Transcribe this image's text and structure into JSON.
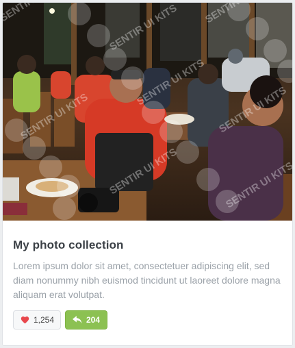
{
  "card": {
    "title": "My photo collection",
    "description": "Lorem ipsum dolor sit amet, consectetuer adipiscing elit, sed diam nonummy nibh euismod tincidunt ut laoreet dolore magna aliquam erat volutpat.",
    "like_count": "1,254",
    "share_count": "204",
    "like_icon": "heart-icon",
    "share_icon": "reply-arrow-icon",
    "colors": {
      "title": "#3b4046",
      "description": "#9aa1a8",
      "heart": "#e8474c",
      "share_bg": "#8cc152"
    }
  },
  "watermark": {
    "text": "SENTIR UI KITS"
  }
}
